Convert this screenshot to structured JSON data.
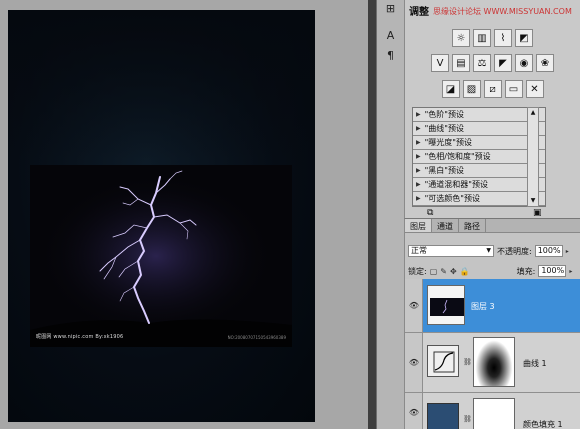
{
  "adjustments_panel": {
    "tab_label": "调整",
    "watermark": "思缘设计论坛 WWW.MISSYUAN.COM",
    "icon_rows": [
      [
        "brightness-icon",
        "levels-icon",
        "curves-icon",
        "exposure-icon"
      ],
      [
        "vibrance-icon",
        "hue-saturation-icon",
        "color-balance-icon",
        "black-white-icon",
        "photo-filter-icon",
        "channel-mixer-icon"
      ],
      [
        "invert-icon",
        "posterize-icon",
        "threshold-icon",
        "gradient-map-icon",
        "selective-color-icon"
      ]
    ],
    "presets": [
      "\"色阶\"预设",
      "\"曲线\"预设",
      "\"曝光度\"预设",
      "\"色相/饱和度\"预设",
      "\"黑白\"预设",
      "\"通道混和器\"预设",
      "\"可选颜色\"预设"
    ]
  },
  "layers_panel": {
    "tabs": [
      "图层",
      "通道",
      "路径"
    ],
    "active_tab": 0,
    "blend_mode": "正常",
    "opacity_label": "不透明度:",
    "opacity_value": "100%",
    "lock_label": "锁定:",
    "fill_label": "填充:",
    "fill_value": "100%",
    "layers": [
      {
        "name": "图层 3",
        "selected": true
      },
      {
        "name": "曲线 1",
        "selected": false
      },
      {
        "name": "颜色填充 1",
        "selected": false
      }
    ]
  },
  "document": {
    "footer_left": "昵图网 www.nipic.com  By:xk1906",
    "footer_right": "NO:20080707150543960389"
  },
  "colors": {
    "selected_layer": "#3d8ed8",
    "panel_bg": "#c9c9c9",
    "canvas_bg": "#050b12",
    "lightning": "#c9b8ff",
    "fill_swatch": "#2b4d73"
  }
}
